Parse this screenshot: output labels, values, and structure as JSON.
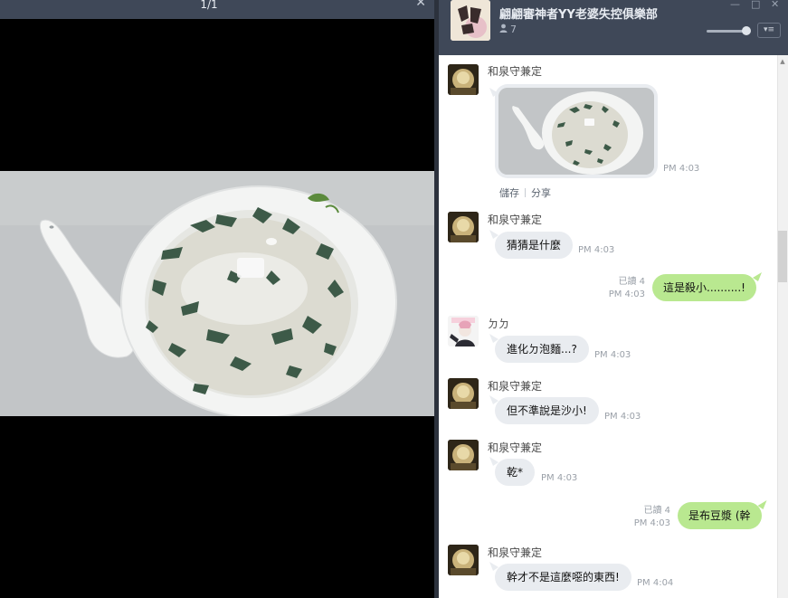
{
  "viewer": {
    "counter": "1/1",
    "close_icon": "close-icon"
  },
  "chat": {
    "group_name": "翩翩審神者YY老婆失控俱樂部",
    "member_count": "7",
    "window_controls": {
      "minimize": "—",
      "maximize": "□",
      "close": "✕"
    },
    "menu_glyph": "▾≡"
  },
  "messages": [
    {
      "sender": "和泉守兼定",
      "type": "image",
      "time": "PM 4:03",
      "actions": [
        "儲存",
        "分享"
      ]
    },
    {
      "sender": "和泉守兼定",
      "text": "猜猜是什麼",
      "time": "PM 4:03"
    },
    {
      "outgoing": true,
      "read": "已讀 4",
      "time": "PM 4:03",
      "text": "這是殺小..........!"
    },
    {
      "sender": "ㄉㄉ",
      "text": "進化ㄉ泡麵...?",
      "time": "PM 4:03"
    },
    {
      "sender": "和泉守兼定",
      "text": "但不準說是沙小!",
      "time": "PM 4:03"
    },
    {
      "sender": "和泉守兼定",
      "text": "乾*",
      "time": "PM 4:03"
    },
    {
      "outgoing": true,
      "read": "已讀 4",
      "time": "PM 4:03",
      "text": "是布豆漿 (幹"
    },
    {
      "sender": "和泉守兼定",
      "text": "幹才不是這麼噁的東西!",
      "time": "PM 4:04"
    }
  ],
  "colors": {
    "header_bg": "#3f4858",
    "outgoing_bubble": "#b9e890",
    "incoming_bubble": "#e9ecf0"
  }
}
